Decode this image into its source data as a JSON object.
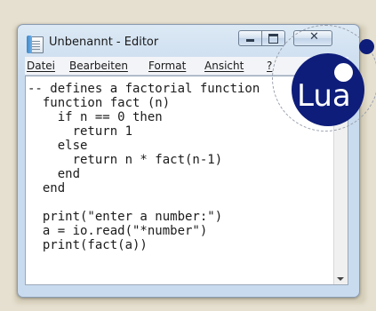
{
  "window": {
    "title": "Unbenannt - Editor"
  },
  "menu": {
    "items": [
      "Datei",
      "Bearbeiten",
      "Format",
      "Ansicht",
      "?"
    ]
  },
  "editor": {
    "lines": [
      "-- defines a factorial function",
      "  function fact (n)",
      "    if n == 0 then",
      "      return 1",
      "    else",
      "      return n * fact(n-1)",
      "    end",
      "  end",
      "",
      "  print(\"enter a number:\")",
      "  a = io.read(\"*number\")",
      "  print(fact(a))"
    ]
  },
  "logo": {
    "text": "Lua",
    "color": "#0e1d7a"
  },
  "icons": {
    "app": "notepad-icon",
    "minimize": "minimize-icon",
    "maximize": "maximize-icon",
    "close": "close-icon",
    "scroll_down": "chevron-down-icon"
  }
}
